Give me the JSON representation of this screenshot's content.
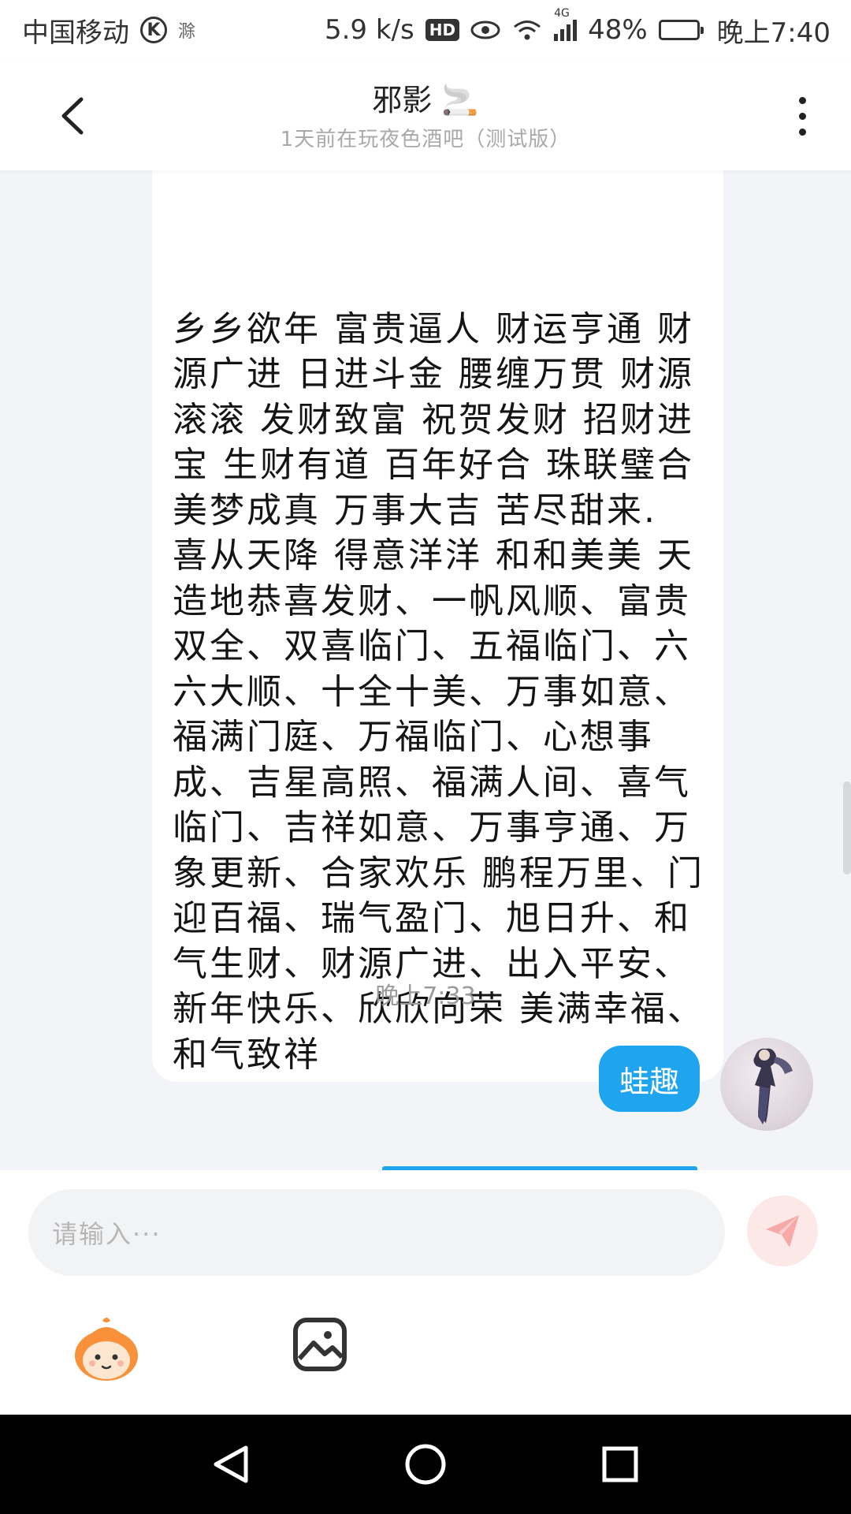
{
  "status_bar": {
    "carrier": "中国移动",
    "carrier_icon": "K",
    "extra_icon": "滁",
    "speed": "5.9 k/s",
    "hd": "HD",
    "network": "4G",
    "battery": "48%",
    "battery_level": 0.48,
    "time": "晚上7:40"
  },
  "header": {
    "title": "邪影",
    "title_emoji": "🚬",
    "subtitle": "1天前在玩夜色酒吧（测试版）"
  },
  "messages": {
    "incoming_text": "乡乡欲年 富贵逼人 财运亨通 财源广进 日进斗金 腰缠万贯 财源滚滚 发财致富 祝贺发财 招财进宝 生财有道 百年好合 珠联璧合 美梦成真 万事大吉 苦尽甜来. 喜从天降 得意洋洋 和和美美 天造地恭喜发财、一帆风顺、富贵双全、双喜临门、五福临门、六六大顺、十全十美、万事如意、福满门庭、万福临门、心想事成、吉星高照、福满人间、喜气临门、吉祥如意、万事亨通、万象更新、合家欢乐 鹏程万里、门迎百福、瑞气盈门、旭日升、和气生财、财源广进、出入平安、新年快乐、欣欣向荣 美满幸福、和气致祥",
    "timestamp": "晚上7:33",
    "outgoing_text": "蛙趣"
  },
  "input": {
    "placeholder": "请输入···"
  },
  "colors": {
    "accent": "#1fa4f0",
    "chat_bg": "#f2f4f7",
    "send_bg": "#fde8e8",
    "send_icon": "#f7a8a8"
  },
  "icons": {
    "back": "chevron-left-icon",
    "more": "more-vertical-icon",
    "send": "paper-plane-icon",
    "emoji": "emoji-face-icon",
    "image": "image-icon",
    "nav_back": "triangle-back-icon",
    "nav_home": "circle-home-icon",
    "nav_recent": "square-recent-icon"
  }
}
